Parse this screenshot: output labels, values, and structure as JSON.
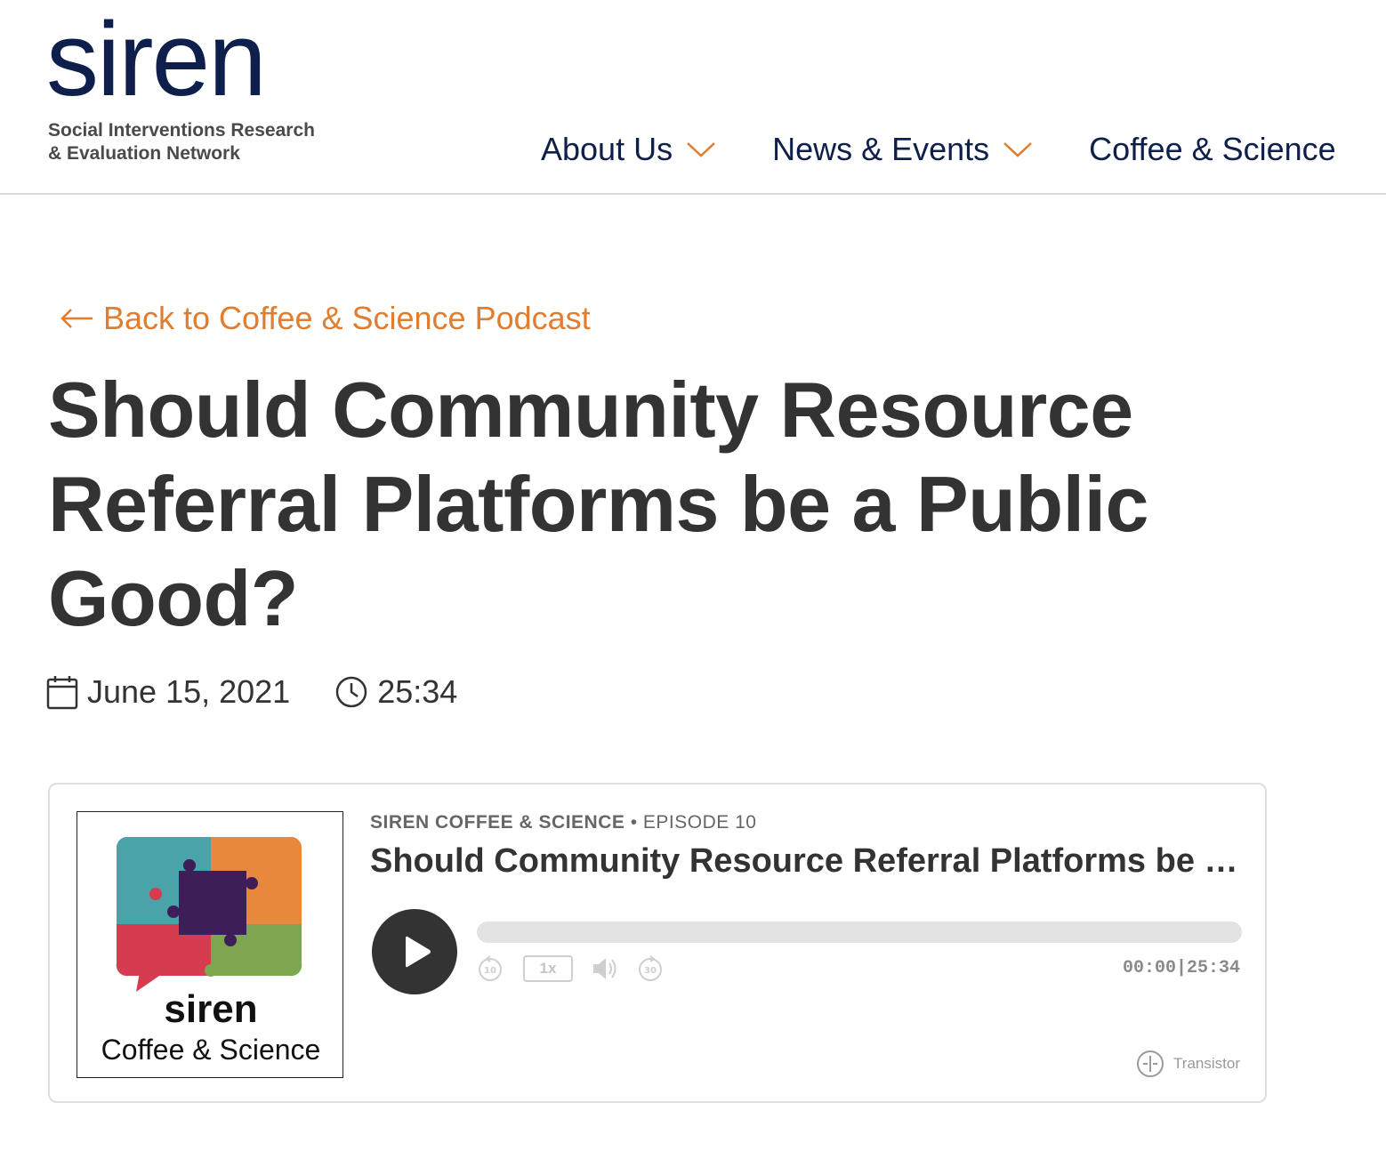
{
  "logo": {
    "wordmark": "siren",
    "subtitle_line1": "Social Interventions Research",
    "subtitle_line2": "& Evaluation Network"
  },
  "nav": {
    "items": [
      {
        "label": "About Us",
        "has_dropdown": true
      },
      {
        "label": "News & Events",
        "has_dropdown": true
      },
      {
        "label": "Coffee & Science",
        "has_dropdown": false
      }
    ]
  },
  "back_link": {
    "label": "Back to Coffee & Science Podcast"
  },
  "article": {
    "title": "Should Community Resource Referral Platforms be a Public Good?",
    "date": "June 15, 2021",
    "duration": "25:34"
  },
  "player": {
    "artwork": {
      "line1": "siren",
      "line2": "Coffee & Science"
    },
    "show_name": "SIREN COFFEE & SCIENCE",
    "separator": "•",
    "episode": "EPISODE 10",
    "episode_title": "Should Community Resource Referral Platforms be a Public Good?",
    "playback_rate": "1x",
    "skip_back_seconds": "10",
    "skip_forward_seconds": "30",
    "current_time": "00:00",
    "total_time": "25:34",
    "progress_fraction": 0,
    "powered_by": "Transistor"
  },
  "colors": {
    "brand_navy": "#0f1f4b",
    "accent_orange": "#e07d2e",
    "text_dark": "#333333",
    "puzzle_teal": "#4aa3a8",
    "puzzle_orange": "#e8883d",
    "puzzle_red": "#d63c50",
    "puzzle_green": "#7da650",
    "puzzle_purple": "#3e1e58"
  }
}
